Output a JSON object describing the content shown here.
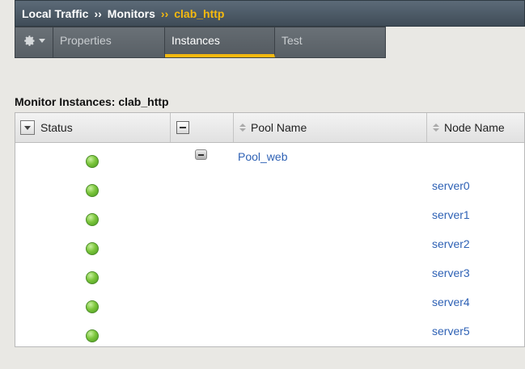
{
  "breadcrumb": {
    "items": [
      "Local Traffic",
      "Monitors"
    ],
    "separator": "››",
    "current": "clab_http"
  },
  "tabs": [
    {
      "label": "Properties",
      "active": false
    },
    {
      "label": "Instances",
      "active": true
    },
    {
      "label": "Test",
      "active": false
    }
  ],
  "section_title": "Monitor Instances: clab_http",
  "table": {
    "columns": [
      "Status",
      "",
      "Pool Name",
      "Node Name"
    ],
    "pool_row": {
      "status": "available",
      "pool": "Pool_web"
    },
    "node_rows": [
      {
        "status": "available",
        "node": "server0"
      },
      {
        "status": "available",
        "node": "server1"
      },
      {
        "status": "available",
        "node": "server2"
      },
      {
        "status": "available",
        "node": "server3"
      },
      {
        "status": "available",
        "node": "server4"
      },
      {
        "status": "available",
        "node": "server5"
      }
    ]
  },
  "colors": {
    "accent": "#f5b90f",
    "link": "#2f62b5",
    "status_green": "#7cc63c",
    "header_bg": "#4a5863"
  },
  "icons": [
    "gear-icon",
    "chevron-down-icon",
    "sort-icon",
    "collapse-icon",
    "status-icon"
  ]
}
